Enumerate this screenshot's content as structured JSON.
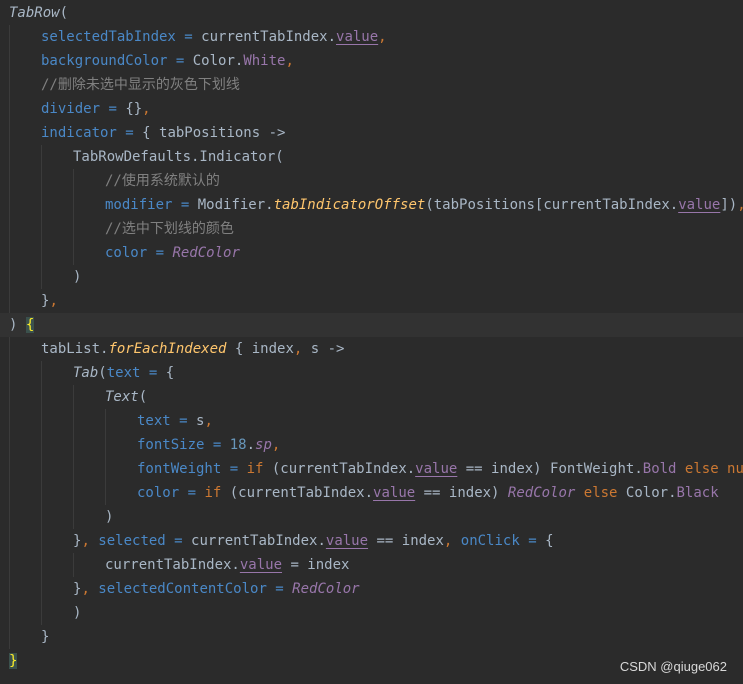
{
  "editor": {
    "current_line": 13,
    "lines": [
      {
        "indent": 0,
        "tokens": [
          {
            "t": "TabRow",
            "c": "fn-italic"
          },
          {
            "t": "(",
            "c": "default"
          }
        ]
      },
      {
        "indent": 1,
        "tokens": [
          {
            "t": "selectedTabIndex",
            "c": "param"
          },
          {
            "t": " = ",
            "c": "param"
          },
          {
            "t": "currentTabIndex.",
            "c": "default"
          },
          {
            "t": "value",
            "c": "prop-u"
          },
          {
            "t": ",",
            "c": "keyword"
          }
        ]
      },
      {
        "indent": 1,
        "tokens": [
          {
            "t": "backgroundColor",
            "c": "param"
          },
          {
            "t": " = ",
            "c": "param"
          },
          {
            "t": "Color.",
            "c": "default"
          },
          {
            "t": "White",
            "c": "prop"
          },
          {
            "t": ",",
            "c": "keyword"
          }
        ]
      },
      {
        "indent": 1,
        "tokens": [
          {
            "t": "//删除未选中显示的灰色下划线",
            "c": "comment"
          }
        ]
      },
      {
        "indent": 1,
        "tokens": [
          {
            "t": "divider",
            "c": "param"
          },
          {
            "t": " = ",
            "c": "param"
          },
          {
            "t": "{}",
            "c": "default"
          },
          {
            "t": ",",
            "c": "keyword"
          }
        ]
      },
      {
        "indent": 1,
        "tokens": [
          {
            "t": "indicator",
            "c": "param"
          },
          {
            "t": " = ",
            "c": "param"
          },
          {
            "t": "{ tabPositions ->",
            "c": "default"
          }
        ]
      },
      {
        "indent": 2,
        "tokens": [
          {
            "t": "TabRowDefaults.Indicator(",
            "c": "default"
          }
        ]
      },
      {
        "indent": 3,
        "tokens": [
          {
            "t": "//使用系统默认的",
            "c": "comment"
          }
        ]
      },
      {
        "indent": 3,
        "tokens": [
          {
            "t": "modifier",
            "c": "param"
          },
          {
            "t": " = ",
            "c": "param"
          },
          {
            "t": "Modifier.",
            "c": "default"
          },
          {
            "t": "tabIndicatorOffset",
            "c": "ext-fn"
          },
          {
            "t": "(tabPositions[currentTabIndex.",
            "c": "default"
          },
          {
            "t": "value",
            "c": "prop-u"
          },
          {
            "t": "])",
            "c": "default"
          },
          {
            "t": ",",
            "c": "keyword"
          }
        ]
      },
      {
        "indent": 3,
        "tokens": [
          {
            "t": "//选中下划线的颜色",
            "c": "comment"
          }
        ]
      },
      {
        "indent": 3,
        "tokens": [
          {
            "t": "color",
            "c": "param"
          },
          {
            "t": " = ",
            "c": "param"
          },
          {
            "t": "RedColor",
            "c": "const-italic"
          }
        ]
      },
      {
        "indent": 2,
        "tokens": [
          {
            "t": ")",
            "c": "default"
          }
        ]
      },
      {
        "indent": 1,
        "tokens": [
          {
            "t": "}",
            "c": "default"
          },
          {
            "t": ",",
            "c": "keyword"
          }
        ]
      },
      {
        "indent": 0,
        "tokens": [
          {
            "t": ") ",
            "c": "default"
          },
          {
            "t": "{",
            "c": "brace-match"
          }
        ]
      },
      {
        "indent": 1,
        "tokens": [
          {
            "t": "tabList.",
            "c": "default"
          },
          {
            "t": "forEachIndexed",
            "c": "ext-fn"
          },
          {
            "t": " { index",
            "c": "default"
          },
          {
            "t": ",",
            "c": "keyword"
          },
          {
            "t": " s ->",
            "c": "default"
          }
        ]
      },
      {
        "indent": 2,
        "tokens": [
          {
            "t": "Tab",
            "c": "fn-italic"
          },
          {
            "t": "(",
            "c": "default"
          },
          {
            "t": "text",
            "c": "param"
          },
          {
            "t": " = ",
            "c": "param"
          },
          {
            "t": "{",
            "c": "default"
          }
        ]
      },
      {
        "indent": 3,
        "tokens": [
          {
            "t": "Text",
            "c": "fn-italic"
          },
          {
            "t": "(",
            "c": "default"
          }
        ]
      },
      {
        "indent": 4,
        "tokens": [
          {
            "t": "text",
            "c": "param"
          },
          {
            "t": " = ",
            "c": "param"
          },
          {
            "t": "s",
            "c": "default"
          },
          {
            "t": ",",
            "c": "keyword"
          }
        ]
      },
      {
        "indent": 4,
        "tokens": [
          {
            "t": "fontSize",
            "c": "param"
          },
          {
            "t": " = ",
            "c": "param"
          },
          {
            "t": "18",
            "c": "number"
          },
          {
            "t": ".",
            "c": "default"
          },
          {
            "t": "sp",
            "c": "unit"
          },
          {
            "t": ",",
            "c": "keyword"
          }
        ]
      },
      {
        "indent": 4,
        "tokens": [
          {
            "t": "fontWeight",
            "c": "param"
          },
          {
            "t": " = ",
            "c": "param"
          },
          {
            "t": "if",
            "c": "keyword"
          },
          {
            "t": " (currentTabIndex.",
            "c": "default"
          },
          {
            "t": "value",
            "c": "prop-u"
          },
          {
            "t": " == index) FontWeight.",
            "c": "default"
          },
          {
            "t": "Bold",
            "c": "prop"
          },
          {
            "t": " else null,",
            "c": "keyword"
          }
        ]
      },
      {
        "indent": 4,
        "tokens": [
          {
            "t": "color",
            "c": "param"
          },
          {
            "t": " = ",
            "c": "param"
          },
          {
            "t": "if",
            "c": "keyword"
          },
          {
            "t": " (currentTabIndex.",
            "c": "default"
          },
          {
            "t": "value",
            "c": "prop-u"
          },
          {
            "t": " == index) ",
            "c": "default"
          },
          {
            "t": "RedColor",
            "c": "const-italic"
          },
          {
            "t": " else ",
            "c": "keyword"
          },
          {
            "t": "Color.",
            "c": "default"
          },
          {
            "t": "Black",
            "c": "prop"
          }
        ]
      },
      {
        "indent": 3,
        "tokens": [
          {
            "t": ")",
            "c": "default"
          }
        ]
      },
      {
        "indent": 2,
        "tokens": [
          {
            "t": "}",
            "c": "default"
          },
          {
            "t": ", ",
            "c": "keyword"
          },
          {
            "t": "selected",
            "c": "param"
          },
          {
            "t": " = ",
            "c": "param"
          },
          {
            "t": "currentTabIndex.",
            "c": "default"
          },
          {
            "t": "value",
            "c": "prop-u"
          },
          {
            "t": " == index",
            "c": "default"
          },
          {
            "t": ", ",
            "c": "keyword"
          },
          {
            "t": "onClick",
            "c": "param"
          },
          {
            "t": " = ",
            "c": "param"
          },
          {
            "t": "{",
            "c": "default"
          }
        ]
      },
      {
        "indent": 3,
        "tokens": [
          {
            "t": "currentTabIndex.",
            "c": "default"
          },
          {
            "t": "value",
            "c": "prop-u"
          },
          {
            "t": " = index",
            "c": "default"
          }
        ]
      },
      {
        "indent": 2,
        "tokens": [
          {
            "t": "}",
            "c": "default"
          },
          {
            "t": ", ",
            "c": "keyword"
          },
          {
            "t": "selectedContentColor",
            "c": "param"
          },
          {
            "t": " = ",
            "c": "param"
          },
          {
            "t": "RedColor",
            "c": "const-italic"
          }
        ]
      },
      {
        "indent": 2,
        "tokens": [
          {
            "t": ")",
            "c": "default"
          }
        ]
      },
      {
        "indent": 1,
        "tokens": [
          {
            "t": "}",
            "c": "default"
          }
        ]
      },
      {
        "indent": 0,
        "tokens": [
          {
            "t": "}",
            "c": "brace-hl"
          }
        ]
      }
    ]
  },
  "watermark": "CSDN @qiuge062",
  "colors": {
    "background": "#2b2b2b",
    "current_line": "#323232",
    "default_text": "#a9b7c6",
    "named_argument": "#4a88c7",
    "property": "#9876aa",
    "keyword": "#cc7832",
    "comment": "#808080",
    "extension_function": "#ffc66d",
    "number": "#6897bb",
    "brace_highlight": "#ffef28"
  }
}
